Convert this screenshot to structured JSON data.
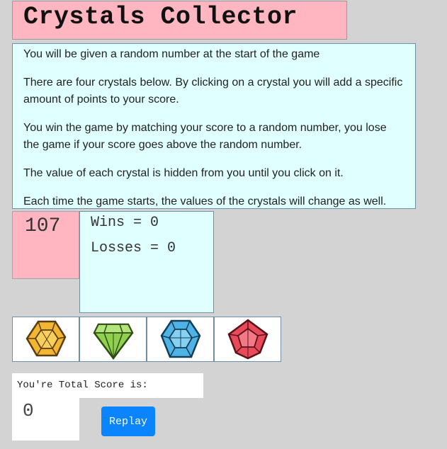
{
  "game": {
    "title": "Crystals Collector",
    "instructions": [
      "You will be given a random number at the start of the game",
      "There are four crystals below. By clicking on a crystal you will add a specific amount of points to your score.",
      "You win the game by matching your score to a random number, you lose the game if your score goes above the random number.",
      "The value of each crystal is hidden from you until you click on it.",
      "Each time the game starts, the values of the crystals will change as well."
    ],
    "target_number": "107",
    "wins_text": "Wins = 0",
    "losses_text": "Losses = 0",
    "score_label": "You're Total Score is:",
    "score_value": "0",
    "replay_label": "Replay"
  },
  "crystals": [
    {
      "icon": "yellow-crystal-icon",
      "color": "#f2b632"
    },
    {
      "icon": "green-crystal-icon",
      "color": "#8fd14f"
    },
    {
      "icon": "blue-crystal-icon",
      "color": "#4fb3e6"
    },
    {
      "icon": "red-crystal-icon",
      "color": "#e84a5a"
    }
  ],
  "colors": {
    "background": "#d3d3d3",
    "pink": "#ffb6c1",
    "light_cyan": "#e0ffff",
    "button": "#0a84ff"
  }
}
